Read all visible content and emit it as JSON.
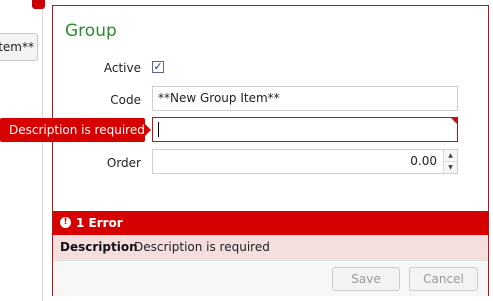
{
  "background": {
    "button_label": "tem**"
  },
  "dialog": {
    "title": "Group",
    "title_color": "#2e8b2e",
    "fields": {
      "active": {
        "label": "Active",
        "checked": true,
        "check_glyph": "✓"
      },
      "code": {
        "label": "Code",
        "value": "**New Group Item**"
      },
      "description": {
        "label": "Description",
        "value": "",
        "has_error": true
      },
      "order": {
        "label": "Order",
        "value": "0.00",
        "up_icon": "▲",
        "down_icon": "▼"
      }
    },
    "validation_tooltip": "Description is required",
    "errors": {
      "title": "1 Error",
      "icon": "!",
      "items": [
        {
          "field": "Description",
          "message": "Description is required"
        }
      ]
    },
    "buttons": {
      "save": "Save",
      "cancel": "Cancel"
    }
  },
  "colors": {
    "error": "#d70000",
    "error_bg": "#f5dede",
    "border": "#c0101a"
  }
}
